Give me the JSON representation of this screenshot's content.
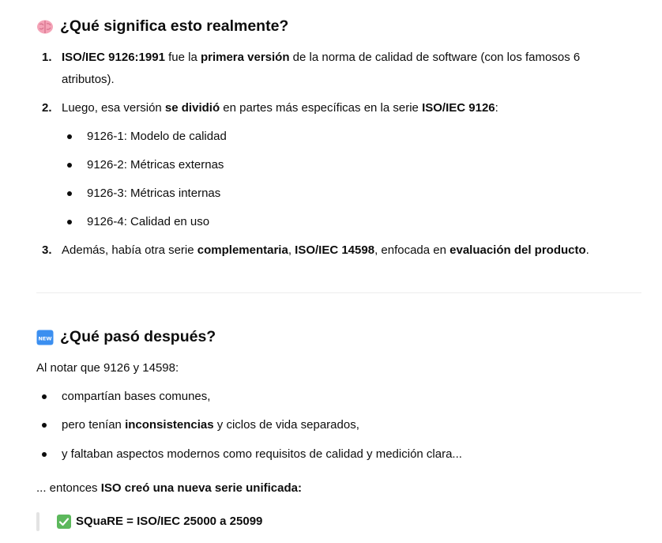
{
  "section1": {
    "icon": "brain-emoji",
    "title": "¿Qué significa esto realmente?",
    "items": [
      {
        "num": "1.",
        "parts": [
          {
            "b": true,
            "t": "ISO/IEC 9126:1991"
          },
          {
            "b": false,
            "t": " fue la "
          },
          {
            "b": true,
            "t": "primera versión"
          },
          {
            "b": false,
            "t": " de la norma de calidad de software (con los famosos 6"
          }
        ],
        "line2": "atributos)."
      },
      {
        "num": "2.",
        "parts": [
          {
            "b": false,
            "t": "Luego, esa versión "
          },
          {
            "b": true,
            "t": "se dividió"
          },
          {
            "b": false,
            "t": " en partes más específicas en la serie "
          },
          {
            "b": true,
            "t": "ISO/IEC 9126"
          },
          {
            "b": false,
            "t": ":"
          }
        ]
      },
      {
        "num": "3.",
        "parts": [
          {
            "b": false,
            "t": "Además, había otra serie "
          },
          {
            "b": true,
            "t": "complementaria"
          },
          {
            "b": false,
            "t": ", "
          },
          {
            "b": true,
            "t": "ISO/IEC 14598"
          },
          {
            "b": false,
            "t": ", enfocada en "
          },
          {
            "b": true,
            "t": "evaluación del producto"
          },
          {
            "b": false,
            "t": "."
          }
        ]
      }
    ],
    "subitems": [
      "9126-1: Modelo de calidad",
      "9126-2: Métricas externas",
      "9126-3: Métricas internas",
      "9126-4: Calidad en uso"
    ]
  },
  "section2": {
    "icon": "new-emoji",
    "icon_text": "NEW",
    "title": "¿Qué pasó después?",
    "intro": "Al notar que 9126 y 14598:",
    "bullets": [
      {
        "parts": [
          {
            "b": false,
            "t": "compartían bases comunes,"
          }
        ]
      },
      {
        "parts": [
          {
            "b": false,
            "t": "pero tenían "
          },
          {
            "b": true,
            "t": "inconsistencias"
          },
          {
            "b": false,
            "t": " y ciclos de vida separados,"
          }
        ]
      },
      {
        "parts": [
          {
            "b": false,
            "t": "y faltaban aspectos modernos como requisitos de calidad y medición clara..."
          }
        ]
      }
    ],
    "conclusion_parts": [
      {
        "b": false,
        "t": "... entonces "
      },
      {
        "b": true,
        "t": "ISO creó una nueva serie unificada:"
      }
    ],
    "quote_icon": "check-mark-emoji",
    "quote": "SQuaRE = ISO/IEC 25000 a 25099"
  }
}
